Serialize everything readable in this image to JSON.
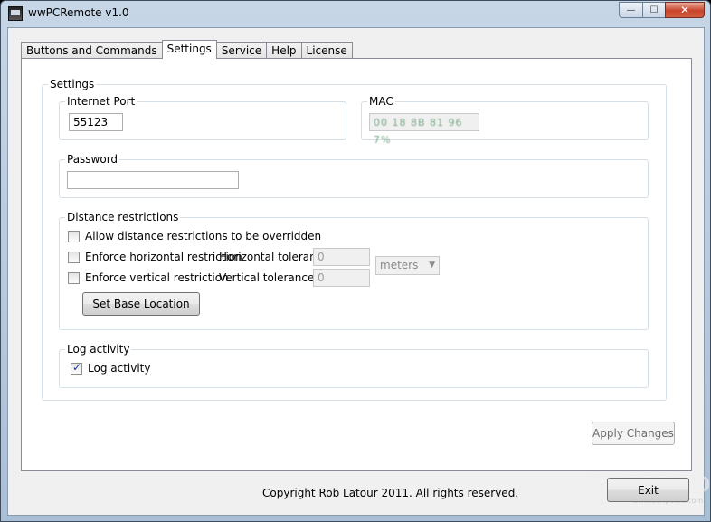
{
  "window": {
    "title": "wwPCRemote v1.0",
    "caption_min": "—",
    "caption_max": "☐",
    "caption_close": "✕"
  },
  "tabs": [
    {
      "label": "Buttons and Commands",
      "active": false
    },
    {
      "label": "Settings",
      "active": true
    },
    {
      "label": "Service",
      "active": false
    },
    {
      "label": "Help",
      "active": false
    },
    {
      "label": "License",
      "active": false
    }
  ],
  "settings": {
    "group_label": "Settings",
    "internet_port": {
      "label": "Internet Port",
      "value": "55123"
    },
    "mac": {
      "label": "MAC",
      "value": "00 18 8B 81 96 7%"
    },
    "password": {
      "label": "Password",
      "value": ""
    },
    "distance": {
      "label": "Distance restrictions",
      "allow_override": {
        "label": "Allow distance restrictions to be overridden",
        "checked": false
      },
      "enforce_horizontal": {
        "label": "Enforce horizontal restriction",
        "checked": false
      },
      "enforce_vertical": {
        "label": "Enforce vertical restriction",
        "checked": false
      },
      "horizontal_tolerance": {
        "label": "Horizontal tolerance:",
        "value": "0"
      },
      "vertical_tolerance": {
        "label": "Vertical tolerance:",
        "value": "0"
      },
      "unit": {
        "selected": "meters"
      },
      "set_base_button": "Set Base Location"
    },
    "log": {
      "label": "Log activity",
      "checkbox": {
        "label": "Log activity",
        "checked": true
      }
    },
    "apply_button": "Apply Changes"
  },
  "footer": {
    "copyright": "Copyright Rob Latour 2011.  All rights reserved.",
    "exit_button": "Exit"
  },
  "watermark": {
    "text": "SOFTPEDIA",
    "url": "www.softpedia.com"
  }
}
